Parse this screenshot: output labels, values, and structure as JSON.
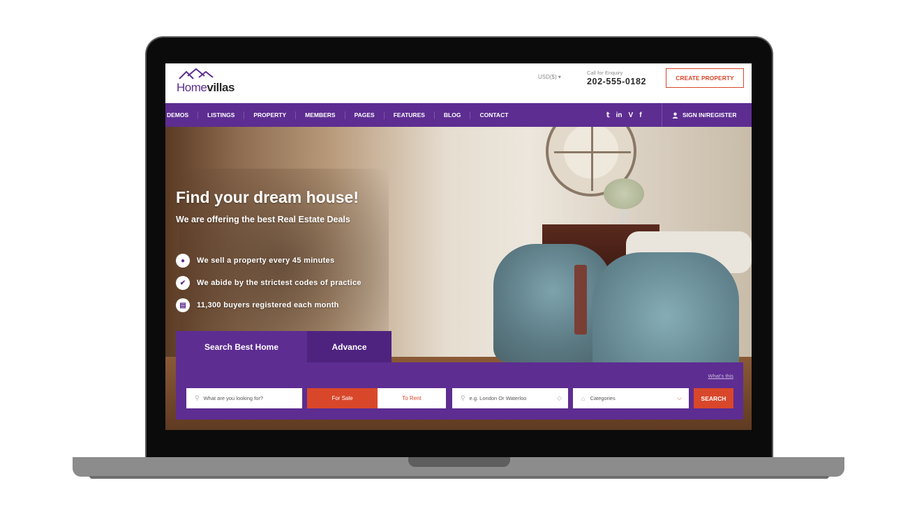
{
  "header": {
    "logo_home": "Home",
    "logo_villas": "villas",
    "currency": "USD($) ▾",
    "enquiry_label": "Call for Enquiry",
    "enquiry_phone": "202-555-0182",
    "create_property": "CREATE PROPERTY"
  },
  "nav": {
    "items": [
      "DEMOS",
      "LISTINGS",
      "PROPERTY",
      "MEMBERS",
      "PAGES",
      "FEATURES",
      "BLOG",
      "CONTACT"
    ],
    "social": [
      "twitter-icon",
      "linkedin-icon",
      "vimeo-icon",
      "facebook-icon"
    ],
    "social_glyphs": [
      "𝕥",
      "in",
      "V",
      "f"
    ],
    "signin": "SIGN IN/REGISTER"
  },
  "hero": {
    "title": "Find your dream house!",
    "subtitle": "We are offering the best Real Estate Deals",
    "features": [
      {
        "icon": "map-pin-icon",
        "glyph": "●",
        "text": "We sell a property every 45 minutes"
      },
      {
        "icon": "check-icon",
        "glyph": "✔",
        "text": "We abide by the strictest codes of practice"
      },
      {
        "icon": "document-icon",
        "glyph": "▤",
        "text": "11,300 buyers registered each month"
      }
    ]
  },
  "search": {
    "tabs": [
      "Search Best Home",
      "Advance"
    ],
    "active_tab": "Search Best Home",
    "whats_this": "What's this",
    "keyword_placeholder": "What are you looking for?",
    "for_sale": "For Sale",
    "to_rent": "To Rent",
    "location_placeholder": "e.g. London Or Waterloo",
    "category": "Categories",
    "search_button": "SEARCH"
  },
  "colors": {
    "brand_purple": "#5d2d91",
    "accent_red": "#d9472b"
  }
}
